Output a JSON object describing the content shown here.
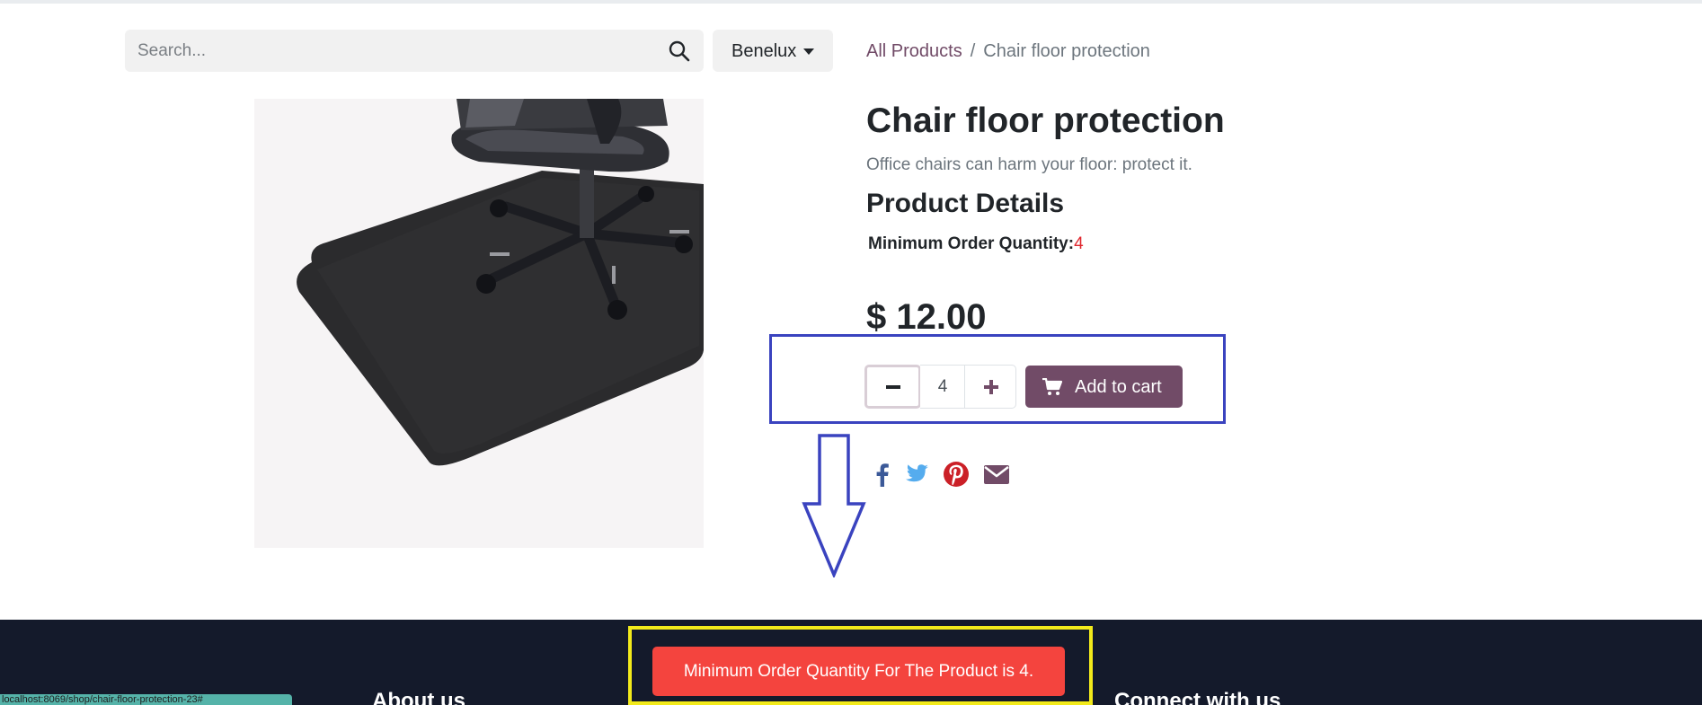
{
  "search": {
    "placeholder": "Search...",
    "icon": "search-icon"
  },
  "region": {
    "selected": "Benelux",
    "icon": "caret-down-icon"
  },
  "breadcrumb": {
    "root": "All Products",
    "separator": "/",
    "current": "Chair floor protection"
  },
  "product": {
    "title": "Chair floor protection",
    "description": "Office chairs can harm your floor: protect it.",
    "details_heading": "Product Details",
    "moq_label": "Minimum Order Quantity:",
    "moq_value": "4",
    "price": "$ 12.00",
    "quantity": "4",
    "add_to_cart": "Add to cart"
  },
  "social": [
    "facebook-icon",
    "twitter-icon",
    "pinterest-icon",
    "envelope-icon"
  ],
  "colors": {
    "brand": "#714b67",
    "annotation_blue": "#3a43bf",
    "annotation_yellow": "#f2ea1b",
    "toast_red": "#f4443e",
    "footer_bg": "#141a2b",
    "moq_value_red": "#e0262d"
  },
  "footer": {
    "about": "About us",
    "connect": "Connect with us"
  },
  "toast": {
    "message": "Minimum Order Quantity For The Product is 4."
  },
  "status_bar": {
    "url": "localhost:8069/shop/chair-floor-protection-23#"
  }
}
